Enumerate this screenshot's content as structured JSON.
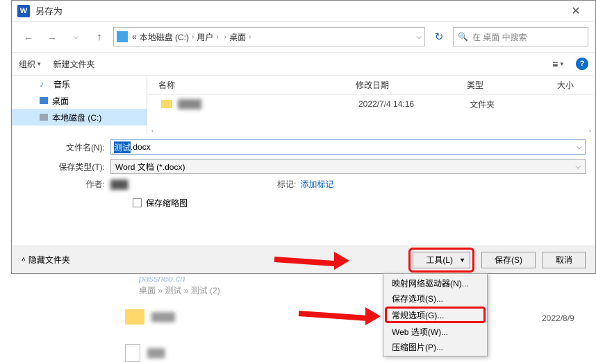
{
  "titlebar": {
    "word_icon": "W",
    "title": "另存为",
    "close": "✕"
  },
  "nav": {
    "back": "←",
    "forward": "→",
    "up": "↑",
    "refresh": "↻",
    "breadcrumb": {
      "seg0": "«",
      "seg1": "本地磁盘 (C:)",
      "seg2": "用户",
      "seg3_hidden": "      ",
      "seg4": "桌面",
      "chev": "›",
      "dd": "⌵"
    },
    "search": {
      "icon": "🔍",
      "placeholder": "在 桌面 中搜索"
    }
  },
  "toolbar": {
    "organize": "组织",
    "newfolder": "新建文件夹",
    "view_icon": "≡",
    "help_icon": "?"
  },
  "sidebar": {
    "items": [
      {
        "icon": "♪",
        "label": "音乐"
      },
      {
        "icon": "",
        "label": "桌面"
      },
      {
        "icon": "",
        "label": "本地磁盘 (C:)"
      }
    ]
  },
  "columns": {
    "name": "名称",
    "date": "修改日期",
    "type": "类型",
    "size": "大小"
  },
  "filelist": {
    "row0": {
      "date": "2022/7/4 14:16",
      "type": "文件夹"
    }
  },
  "form": {
    "filename_label": "文件名(N):",
    "filename_selected": "测试",
    "filename_rest": ".docx",
    "type_label": "保存类型(T):",
    "type_value": "Word 文档 (*.docx)",
    "author_label": "作者:",
    "tags_label": "标记:",
    "add_tag": "添加标记",
    "thumbnail": "保存缩略图"
  },
  "bottom": {
    "hide_folders": "隐藏文件夹",
    "tools": "工具(L)",
    "save": "保存(S)",
    "cancel": "取消"
  },
  "dropdown": {
    "items": {
      "i0": "映射网络驱动器(N)...",
      "i1": "保存选项(S)...",
      "i2": "常规选项(G)...",
      "i3": "Web 选项(W)...",
      "i4": "压缩图片(P)..."
    }
  },
  "background": {
    "watermark": "passneo.cn",
    "crumb": "桌面 » 测试 » 测试 (2)",
    "date1": "2022/8/9"
  }
}
